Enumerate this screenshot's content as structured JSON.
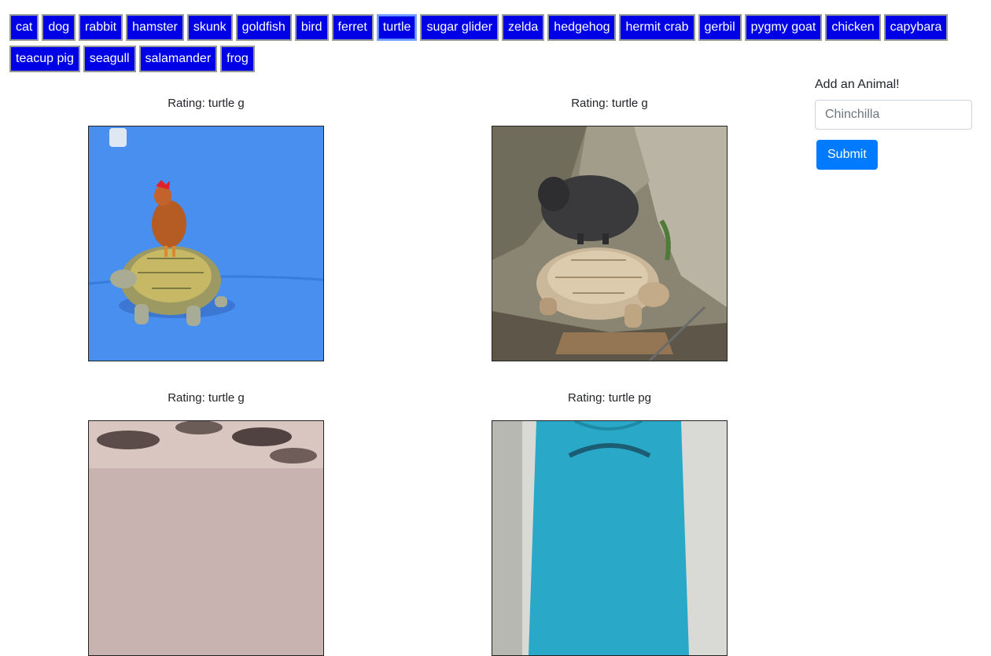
{
  "animals": [
    {
      "label": "cat",
      "active": false
    },
    {
      "label": "dog",
      "active": false
    },
    {
      "label": "rabbit",
      "active": false
    },
    {
      "label": "hamster",
      "active": false
    },
    {
      "label": "skunk",
      "active": false
    },
    {
      "label": "goldfish",
      "active": false
    },
    {
      "label": "bird",
      "active": false
    },
    {
      "label": "ferret",
      "active": false
    },
    {
      "label": "turtle",
      "active": true
    },
    {
      "label": "sugar glider",
      "active": false
    },
    {
      "label": "zelda",
      "active": false
    },
    {
      "label": "hedgehog",
      "active": false
    },
    {
      "label": "hermit crab",
      "active": false
    },
    {
      "label": "gerbil",
      "active": false
    },
    {
      "label": "pygmy goat",
      "active": false
    },
    {
      "label": "chicken",
      "active": false
    },
    {
      "label": "capybara",
      "active": false
    },
    {
      "label": "teacup pig",
      "active": false
    },
    {
      "label": "seagull",
      "active": false
    },
    {
      "label": "salamander",
      "active": false
    },
    {
      "label": "frog",
      "active": false
    }
  ],
  "gifs": [
    {
      "rating": "Rating: turtle g"
    },
    {
      "rating": "Rating: turtle g"
    },
    {
      "rating": "Rating: turtle g"
    },
    {
      "rating": "Rating: turtle pg"
    }
  ],
  "form": {
    "label": "Add an Animal!",
    "placeholder": "Chinchilla",
    "value": "",
    "submit_label": "Submit"
  },
  "colors": {
    "animal_button_bg": "#0000e6",
    "submit_button_bg": "#007bff"
  }
}
